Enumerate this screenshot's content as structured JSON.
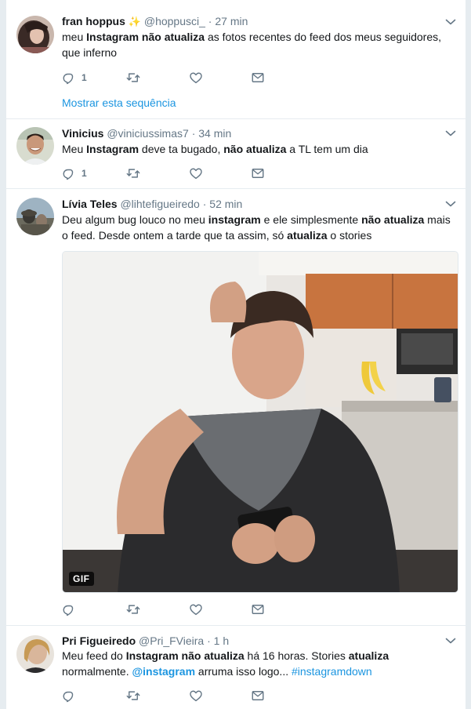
{
  "colors": {
    "link": "#1b95e0",
    "muted": "#657786",
    "text": "#14171a",
    "bg": "#e6ecf0"
  },
  "tweets": [
    {
      "fullname": "fran hoppus",
      "badge": "✨",
      "screen_name": "@hoppusci_",
      "sep": "·",
      "time": "27 min",
      "text": [
        {
          "t": "meu ",
          "b": false
        },
        {
          "t": "Instagram não atualiza",
          "b": true
        },
        {
          "t": " as fotos recentes do feed dos meus seguidores, que inferno",
          "b": false
        }
      ],
      "reply_count": "1",
      "thread_link": "Mostrar esta sequência"
    },
    {
      "fullname": "Vinicius",
      "screen_name": "@viniciussimas7",
      "sep": "·",
      "time": "34 min",
      "text": [
        {
          "t": "Meu ",
          "b": false
        },
        {
          "t": "Instagram",
          "b": true
        },
        {
          "t": " deve ta bugado, ",
          "b": false
        },
        {
          "t": "não atualiza",
          "b": true
        },
        {
          "t": " a TL tem um dia",
          "b": false
        }
      ],
      "reply_count": "1"
    },
    {
      "fullname": "Lívia Teles",
      "screen_name": "@lihtefigueiredo",
      "sep": "·",
      "time": "52 min",
      "text": [
        {
          "t": "Deu algum bug louco no meu ",
          "b": false
        },
        {
          "t": "instagram",
          "b": true
        },
        {
          "t": " e ele simplesmente ",
          "b": false
        },
        {
          "t": "não atualiza",
          "b": true
        },
        {
          "t": " mais o feed. Desde ontem a tarde que ta assim, só ",
          "b": false
        },
        {
          "t": "atualiza",
          "b": true
        },
        {
          "t": " o stories",
          "b": false
        }
      ],
      "media_badge": "GIF"
    },
    {
      "fullname": "Pri Figueiredo",
      "screen_name": "@Pri_FVieira",
      "sep": "·",
      "time": "1 h",
      "text": [
        {
          "t": "Meu feed do ",
          "b": false
        },
        {
          "t": "Instagram não atualiza",
          "b": true
        },
        {
          "t": " há 16 horas. Stories ",
          "b": false
        },
        {
          "t": "atualiza",
          "b": true
        },
        {
          "t": " normalmente. ",
          "b": false
        },
        {
          "t": "@instagram",
          "b": true,
          "link": true
        },
        {
          "t": " arruma isso logo... ",
          "b": false
        },
        {
          "t": "#instagramdown",
          "b": false,
          "link": true
        }
      ]
    }
  ]
}
